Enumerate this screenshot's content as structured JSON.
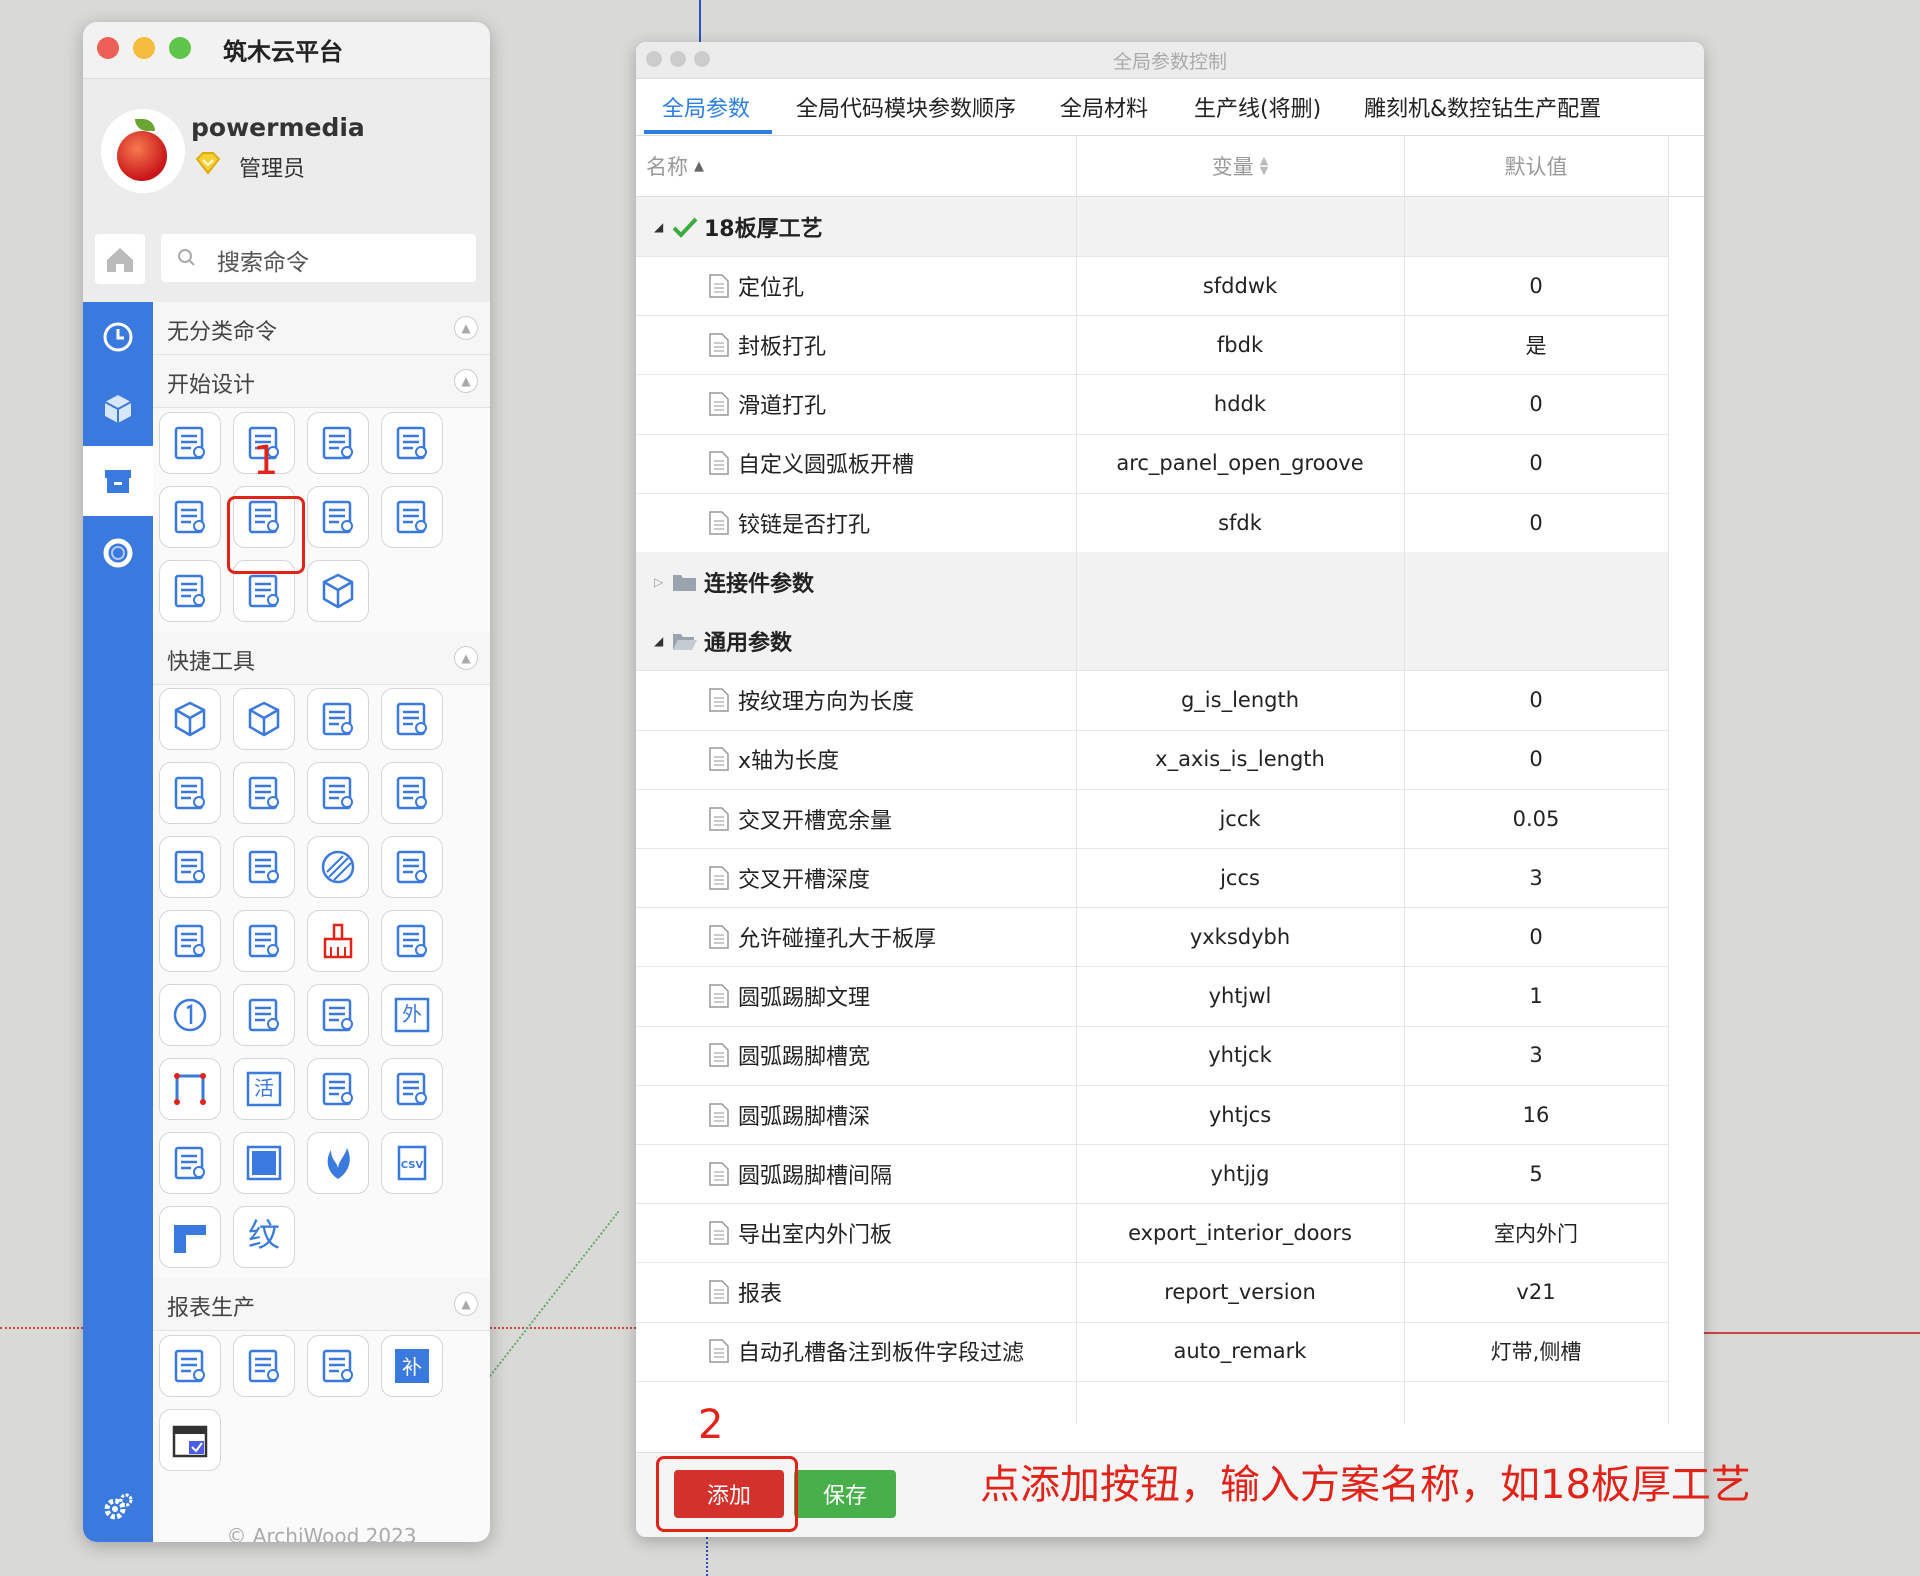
{
  "panel": {
    "title": "筑木云平台",
    "user": {
      "name": "powermedia",
      "role": "管理员"
    },
    "search": {
      "placeholder": "搜索命令"
    },
    "sidebar": {
      "icons": [
        "home-icon",
        "clock-icon",
        "cube-icon",
        "box-icon",
        "ring-icon",
        "gear-icon"
      ]
    },
    "sections": [
      {
        "label": "无分类命令"
      },
      {
        "label": "开始设计"
      },
      {
        "label": "快捷工具"
      },
      {
        "label": "报表生产"
      }
    ],
    "tiles": {
      "kaishi": [
        "param-list-icon",
        "folder-cube-icon",
        "layout-icon",
        "panel-edit-icon",
        "copy-edit-icon",
        "settings-form-icon",
        "quote-doc-icon",
        "tree-icon",
        "arc-panel-icon",
        "tilt-panel-icon",
        "cube-outline-icon"
      ],
      "kuaijie": [
        "cube-3d-icon",
        "rotate-cube-icon",
        "panel-gear-icon",
        "panel-eye-icon",
        "cabinet-icon",
        "dashed-edit-icon",
        "corner-icon",
        "frame-icon",
        "measure-icon",
        "tools-icon",
        "hatch-icon",
        "pencil-icon",
        "door-arrow-icon",
        "hand-edit-icon",
        "brush-icon",
        "trash-doc-icon",
        "circle-one-icon",
        "square-edit-icon",
        "split-panel-icon",
        "wai-char-icon",
        "red-corner-icon",
        "huo-char-icon",
        "doc-cube-icon",
        "list-edit-icon",
        "export-icon",
        "solid-square-icon",
        "flame-icon",
        "csv-icon",
        "angle-block-icon",
        "wen-char-icon"
      ],
      "baobiao": [
        "report-search-icon",
        "report-gear-icon",
        "report-edit-icon",
        "bu-char-icon",
        "calendar-check-icon"
      ]
    },
    "tile_chars": {
      "wai": "外",
      "huo": "活",
      "wen": "纹",
      "bu": "补",
      "csv": "CSV"
    },
    "copyright": "© ArchiWood 2023",
    "step1_label": "1"
  },
  "dialog": {
    "title": "全局参数控制",
    "tabs": [
      "全局参数",
      "全局代码模块参数顺序",
      "全局材料",
      "生产线(将删)",
      "雕刻机&数控钻生产配置"
    ],
    "active_tab": 0,
    "columns": {
      "name": "名称",
      "variable": "变量",
      "default": "默认值"
    },
    "rows": [
      {
        "type": "group",
        "expanded": true,
        "icon": "check-icon",
        "name": "18板厚工艺",
        "var": "",
        "def": ""
      },
      {
        "type": "item",
        "name": "定位孔",
        "var": "sfddwk",
        "def": "0"
      },
      {
        "type": "item",
        "name": "封板打孔",
        "var": "fbdk",
        "def": "是"
      },
      {
        "type": "item",
        "name": "滑道打孔",
        "var": "hddk",
        "def": "0"
      },
      {
        "type": "item",
        "name": "自定义圆弧板开槽",
        "var": "arc_panel_open_groove",
        "def": "0"
      },
      {
        "type": "item",
        "name": "铰链是否打孔",
        "var": "sfdk",
        "def": "0"
      },
      {
        "type": "group",
        "expanded": false,
        "icon": "folder-icon",
        "name": "连接件参数",
        "var": "",
        "def": ""
      },
      {
        "type": "group",
        "expanded": true,
        "icon": "folder-open-icon",
        "name": "通用参数",
        "var": "",
        "def": ""
      },
      {
        "type": "item",
        "name": "按纹理方向为长度",
        "var": "g_is_length",
        "def": "0"
      },
      {
        "type": "item",
        "name": "x轴为长度",
        "var": "x_axis_is_length",
        "def": "0"
      },
      {
        "type": "item",
        "name": "交叉开槽宽余量",
        "var": "jcck",
        "def": "0.05"
      },
      {
        "type": "item",
        "name": "交叉开槽深度",
        "var": "jccs",
        "def": "3"
      },
      {
        "type": "item",
        "name": "允许碰撞孔大于板厚",
        "var": "yxksdybh",
        "def": "0"
      },
      {
        "type": "item",
        "name": "圆弧踢脚文理",
        "var": "yhtjwl",
        "def": "1"
      },
      {
        "type": "item",
        "name": "圆弧踢脚槽宽",
        "var": "yhtjck",
        "def": "3"
      },
      {
        "type": "item",
        "name": "圆弧踢脚槽深",
        "var": "yhtjcs",
        "def": "16"
      },
      {
        "type": "item",
        "name": "圆弧踢脚槽间隔",
        "var": "yhtjjg",
        "def": "5"
      },
      {
        "type": "item",
        "name": "导出室内外门板",
        "var": "export_interior_doors",
        "def": "室内外门"
      },
      {
        "type": "item",
        "name": "报表",
        "var": "report_version",
        "def": "v21"
      },
      {
        "type": "item",
        "name": "自动孔槽备注到板件字段过滤",
        "var": "auto_remark",
        "def": "灯带,侧槽"
      }
    ],
    "buttons": {
      "add": "添加",
      "save": "保存"
    },
    "step2_label": "2"
  },
  "annotation": "点添加按钮，输入方案名称，如18板厚工艺",
  "colors": {
    "accent": "#3a79dd",
    "tab_active": "#2d7fe0",
    "add_btn": "#d3322c",
    "save_btn": "#48b04a",
    "highlight": "#e2231a"
  }
}
